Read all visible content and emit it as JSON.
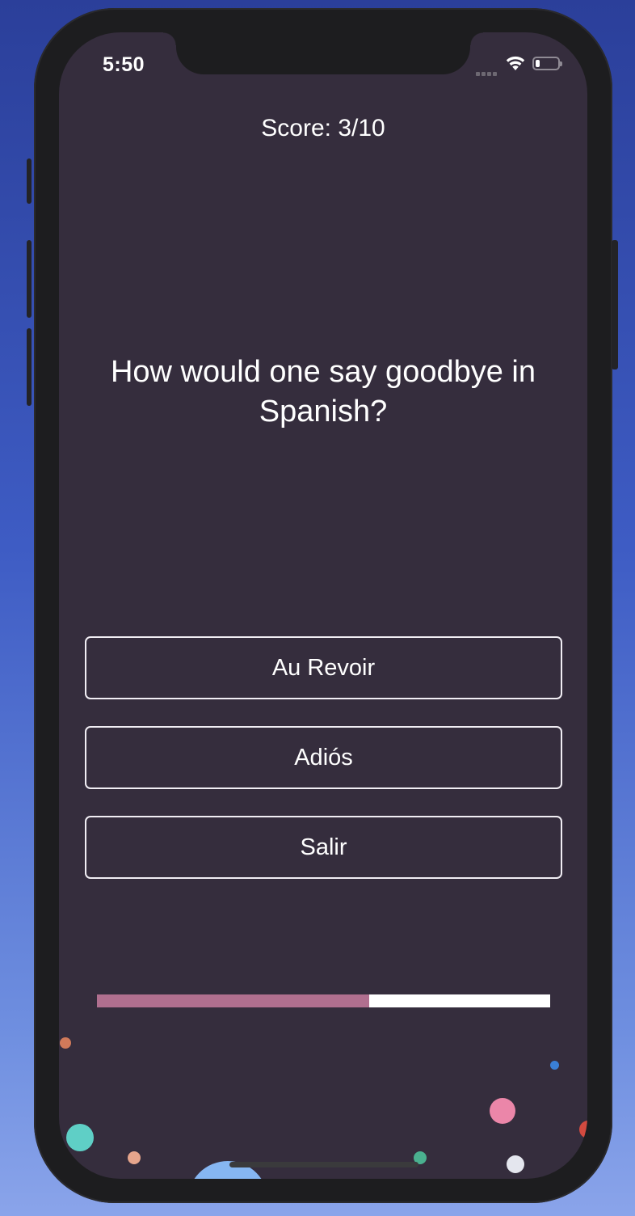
{
  "status_bar": {
    "time": "5:50",
    "battery_level": 0.2
  },
  "quiz": {
    "score_text": "Score: 3/10",
    "question": "How would one say goodbye in Spanish?",
    "answers": [
      {
        "label": "Au Revoir"
      },
      {
        "label": "Adiós"
      },
      {
        "label": "Salir"
      }
    ],
    "progress": 0.6
  },
  "icons": {
    "signal": "cellular-signal-icon",
    "wifi": "wifi-icon",
    "battery": "battery-icon"
  },
  "colors": {
    "screen_background": "#352d3d",
    "progress_fill": "#b06f8f",
    "progress_track": "#ffffff",
    "answer_border": "#f1eef4",
    "text": "#ffffff"
  },
  "confetti_colors": [
    "#5fcfc6",
    "#eb86a9",
    "#e6a58c",
    "#3a7fd5",
    "#4ab08f",
    "#e4e6ee",
    "#d34a3f",
    "#86b6f2",
    "#d07a5a"
  ]
}
